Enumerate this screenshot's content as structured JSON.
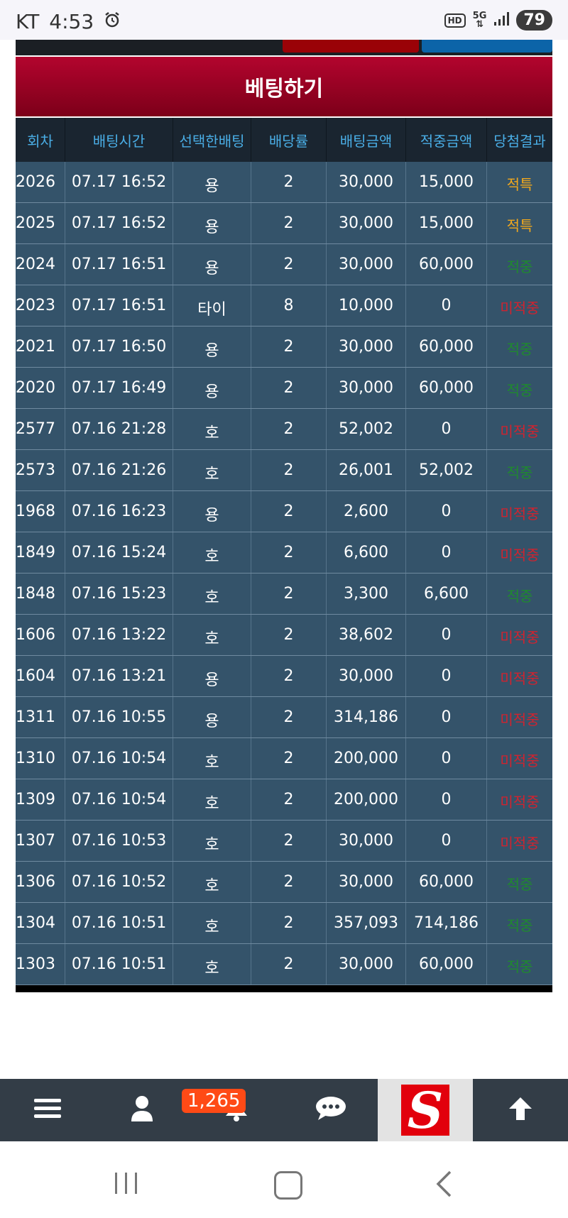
{
  "status": {
    "carrier": "KT",
    "time": "4:53",
    "hd_label": "HD",
    "net_label": "5G",
    "battery": "79"
  },
  "title": "베팅하기",
  "table": {
    "headers": [
      "회차",
      "배팅시간",
      "선택한배팅",
      "배당률",
      "배팅금액",
      "적중금액",
      "당첨결과"
    ],
    "rows": [
      {
        "round": "2026",
        "time": "07.17 16:52",
        "pick": "용",
        "odds": "2",
        "bet": "30,000",
        "win": "15,000",
        "result": "적특",
        "status": "special"
      },
      {
        "round": "2025",
        "time": "07.17 16:52",
        "pick": "용",
        "odds": "2",
        "bet": "30,000",
        "win": "15,000",
        "result": "적특",
        "status": "special"
      },
      {
        "round": "2024",
        "time": "07.17 16:51",
        "pick": "용",
        "odds": "2",
        "bet": "30,000",
        "win": "60,000",
        "result": "적중",
        "status": "win"
      },
      {
        "round": "2023",
        "time": "07.17 16:51",
        "pick": "타이",
        "odds": "8",
        "bet": "10,000",
        "win": "0",
        "result": "미적중",
        "status": "lose"
      },
      {
        "round": "2021",
        "time": "07.17 16:50",
        "pick": "용",
        "odds": "2",
        "bet": "30,000",
        "win": "60,000",
        "result": "적중",
        "status": "win"
      },
      {
        "round": "2020",
        "time": "07.17 16:49",
        "pick": "용",
        "odds": "2",
        "bet": "30,000",
        "win": "60,000",
        "result": "적중",
        "status": "win"
      },
      {
        "round": "2577",
        "time": "07.16 21:28",
        "pick": "호",
        "odds": "2",
        "bet": "52,002",
        "win": "0",
        "result": "미적중",
        "status": "lose"
      },
      {
        "round": "2573",
        "time": "07.16 21:26",
        "pick": "호",
        "odds": "2",
        "bet": "26,001",
        "win": "52,002",
        "result": "적중",
        "status": "win"
      },
      {
        "round": "1968",
        "time": "07.16 16:23",
        "pick": "용",
        "odds": "2",
        "bet": "2,600",
        "win": "0",
        "result": "미적중",
        "status": "lose"
      },
      {
        "round": "1849",
        "time": "07.16 15:24",
        "pick": "호",
        "odds": "2",
        "bet": "6,600",
        "win": "0",
        "result": "미적중",
        "status": "lose"
      },
      {
        "round": "1848",
        "time": "07.16 15:23",
        "pick": "호",
        "odds": "2",
        "bet": "3,300",
        "win": "6,600",
        "result": "적중",
        "status": "win"
      },
      {
        "round": "1606",
        "time": "07.16 13:22",
        "pick": "호",
        "odds": "2",
        "bet": "38,602",
        "win": "0",
        "result": "미적중",
        "status": "lose"
      },
      {
        "round": "1604",
        "time": "07.16 13:21",
        "pick": "용",
        "odds": "2",
        "bet": "30,000",
        "win": "0",
        "result": "미적중",
        "status": "lose"
      },
      {
        "round": "1311",
        "time": "07.16 10:55",
        "pick": "용",
        "odds": "2",
        "bet": "314,186",
        "win": "0",
        "result": "미적중",
        "status": "lose"
      },
      {
        "round": "1310",
        "time": "07.16 10:54",
        "pick": "호",
        "odds": "2",
        "bet": "200,000",
        "win": "0",
        "result": "미적중",
        "status": "lose"
      },
      {
        "round": "1309",
        "time": "07.16 10:54",
        "pick": "호",
        "odds": "2",
        "bet": "200,000",
        "win": "0",
        "result": "미적중",
        "status": "lose"
      },
      {
        "round": "1307",
        "time": "07.16 10:53",
        "pick": "호",
        "odds": "2",
        "bet": "30,000",
        "win": "0",
        "result": "미적중",
        "status": "lose"
      },
      {
        "round": "1306",
        "time": "07.16 10:52",
        "pick": "호",
        "odds": "2",
        "bet": "30,000",
        "win": "60,000",
        "result": "적중",
        "status": "win"
      },
      {
        "round": "1304",
        "time": "07.16 10:51",
        "pick": "호",
        "odds": "2",
        "bet": "357,093",
        "win": "714,186",
        "result": "적중",
        "status": "win"
      },
      {
        "round": "1303",
        "time": "07.16 10:51",
        "pick": "호",
        "odds": "2",
        "bet": "30,000",
        "win": "60,000",
        "result": "적중",
        "status": "win"
      }
    ]
  },
  "result_colors": {
    "special": "#f2a81c",
    "win": "#1f8a2e",
    "lose": "#d0232f"
  },
  "bottom_nav": {
    "notification_count": "1,265",
    "icons": [
      "menu-icon",
      "user-icon",
      "bell-icon",
      "chat-icon",
      "site-logo",
      "arrow-up-icon"
    ],
    "logo_letter": "S"
  }
}
